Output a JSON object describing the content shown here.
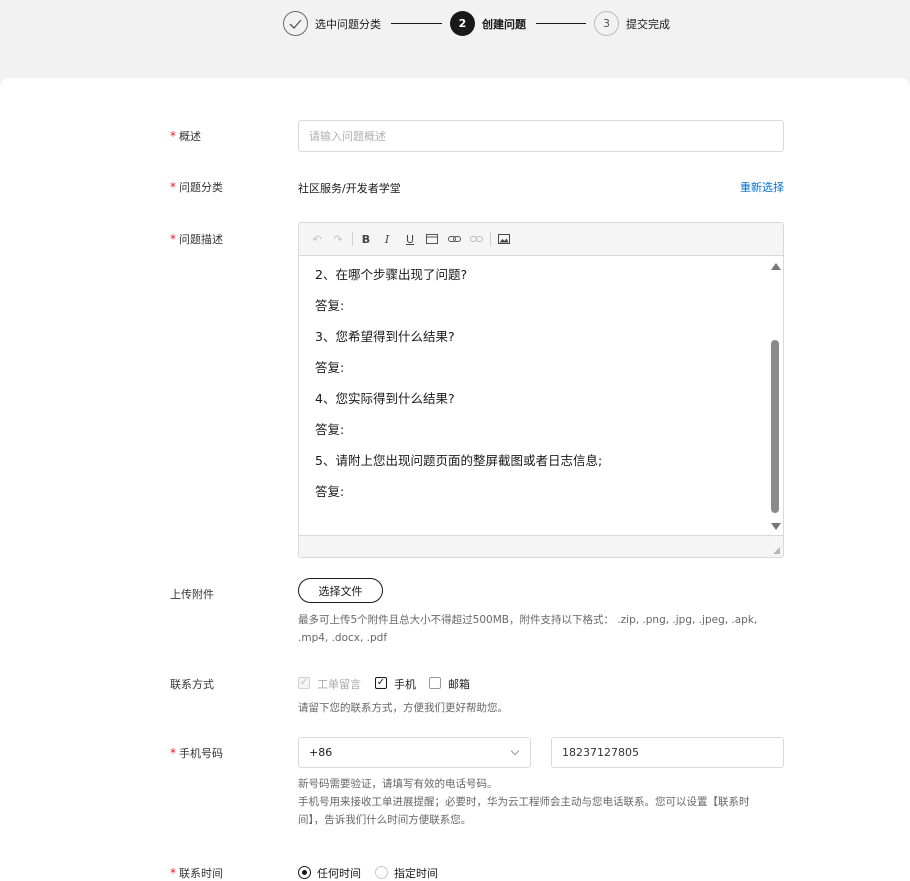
{
  "stepper": {
    "steps": [
      {
        "number": "",
        "label": "选中问题分类",
        "state": "done"
      },
      {
        "number": "2",
        "label": "创建问题",
        "state": "active"
      },
      {
        "number": "3",
        "label": "提交完成",
        "state": "todo"
      }
    ]
  },
  "form": {
    "summary": {
      "label": "概述",
      "placeholder": "请输入问题概述",
      "value": ""
    },
    "category": {
      "label": "问题分类",
      "value": "社区服务/开发者学堂",
      "reselect_link": "重新选择"
    },
    "description": {
      "label": "问题描述",
      "toolbar": [
        "undo-icon",
        "redo-icon",
        "bold-icon",
        "italic-icon",
        "underline-icon",
        "code-icon",
        "link-icon",
        "unlink-icon",
        "image-icon"
      ],
      "lines": [
        "2、在哪个步骤出现了问题?",
        "答复:",
        "3、您希望得到什么结果?",
        "答复:",
        "4、您实际得到什么结果?",
        "答复:",
        "5、请附上您出现问题页面的整屏截图或者日志信息;",
        "答复:"
      ]
    },
    "attachment": {
      "label": "上传附件",
      "button": "选择文件",
      "help_line1": "最多可上传5个附件且总大小不得超过500MB，附件支持以下格式： .zip, .png, .jpg, .jpeg, .apk,",
      "help_line2": ".mp4, .docx, .pdf"
    },
    "contact": {
      "label": "联系方式",
      "options": [
        {
          "label": "工单留言",
          "checked": true,
          "disabled": true
        },
        {
          "label": "手机",
          "checked": true,
          "disabled": false
        },
        {
          "label": "邮箱",
          "checked": false,
          "disabled": false
        }
      ],
      "help": "请留下您的联系方式，方便我们更好帮助您。"
    },
    "phone": {
      "label": "手机号码",
      "country_code": "+86",
      "number": "18237127805",
      "help_line1": "新号码需要验证，请填写有效的电话号码。",
      "help_line2": "手机号用来接收工单进展提醒；必要时，华为云工程师会主动与您电话联系。您可以设置【联系时",
      "help_line3": "间】，告诉我们什么时间方便联系您。"
    },
    "contact_time": {
      "label": "联系时间",
      "options": [
        {
          "label": "任何时间",
          "checked": true
        },
        {
          "label": "指定时间",
          "checked": false
        }
      ]
    }
  },
  "colors": {
    "accent": "#191919",
    "link": "#0070cc",
    "required": "#e0202d",
    "background": "#f2f2f2"
  }
}
